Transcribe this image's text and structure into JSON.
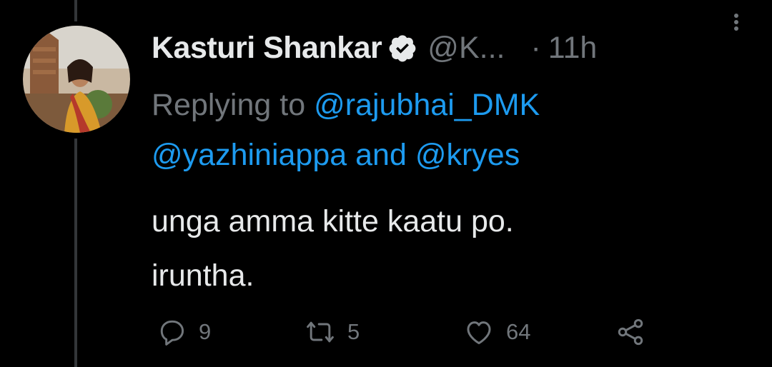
{
  "tweet": {
    "display_name": "Kasturi Shankar",
    "handle": "@K...",
    "separator": "·",
    "time": "11h",
    "reply_prefix": "Replying to",
    "mention_1": "@rajubhai_DMK",
    "mention_2": "@yazhiniappa",
    "reply_and": "and",
    "mention_3": "@kryes",
    "text_line_1": "unga amma kitte kaatu po.",
    "text_line_2": "iruntha."
  },
  "actions": {
    "reply_count": "9",
    "retweet_count": "5",
    "like_count": "64"
  },
  "colors": {
    "background": "#000000",
    "text": "#e7e9ea",
    "secondary": "#71767b",
    "accent": "#1d9bf0"
  },
  "icons": [
    "verified-badge-icon",
    "more-icon",
    "reply-icon",
    "retweet-icon",
    "like-icon",
    "share-icon"
  ]
}
